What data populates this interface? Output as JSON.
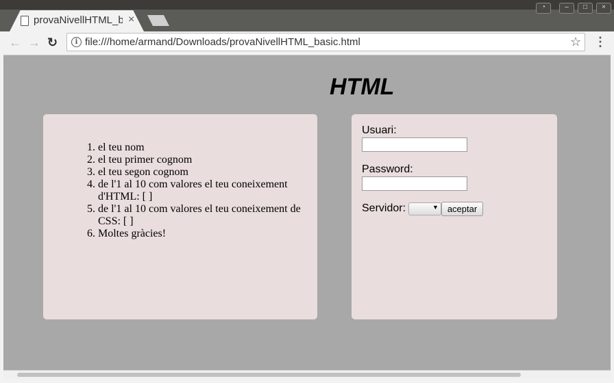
{
  "browser": {
    "tab_title": "provaNivellHTML_b",
    "tab_close": "×",
    "url": "file:///home/armand/Downloads/provaNivellHTML_basic.html",
    "back_icon": "arrow-left-icon",
    "forward_icon": "arrow-right-icon",
    "reload_icon": "reload-icon",
    "bookmark_icon": "star-icon",
    "menu_icon": "kebab-menu-icon"
  },
  "page": {
    "title": "HTML",
    "background_color": "#a8a8a8",
    "panel_color": "#e9dddd",
    "questions": [
      "el teu nom",
      "el teu primer cognom",
      "el teu segon cognom",
      "de l'1 al 10 com valores el teu coneixement d'HTML: [ ]",
      "de l'1 al 10 com valores el teu coneixement de CSS: [ ]",
      "Moltes gràcies!"
    ],
    "form": {
      "user_label": "Usuari:",
      "user_value": "",
      "password_label": "Password:",
      "password_value": "",
      "server_label": "Servidor:",
      "server_selected": "",
      "submit_label": "aceptar"
    }
  }
}
